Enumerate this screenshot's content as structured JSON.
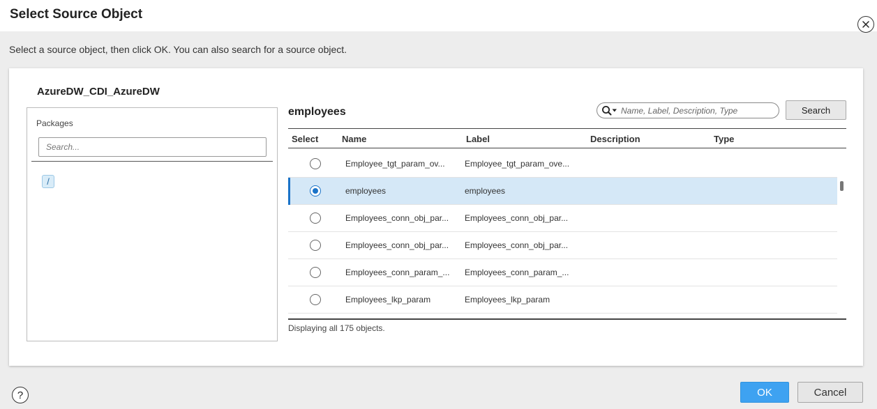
{
  "dialog": {
    "title": "Select Source Object",
    "instruction": "Select a source object, then click OK. You can also search for a source object."
  },
  "connection": {
    "name": "AzureDW_CDI_AzureDW"
  },
  "packages": {
    "label": "Packages",
    "search_placeholder": "Search...",
    "root": "/"
  },
  "objects": {
    "title": "employees",
    "search_placeholder": "Name, Label, Description, Type",
    "search_button": "Search",
    "columns": {
      "select": "Select",
      "name": "Name",
      "label": "Label",
      "description": "Description",
      "type": "Type"
    },
    "rows": [
      {
        "name": "Employee_tgt_param_ov...",
        "label": "Employee_tgt_param_ove...",
        "selected": false
      },
      {
        "name": "employees",
        "label": "employees",
        "selected": true
      },
      {
        "name": "Employees_conn_obj_par...",
        "label": "Employees_conn_obj_par...",
        "selected": false
      },
      {
        "name": "Employees_conn_obj_par...",
        "label": "Employees_conn_obj_par...",
        "selected": false
      },
      {
        "name": "Employees_conn_param_...",
        "label": "Employees_conn_param_...",
        "selected": false
      },
      {
        "name": "Employees_lkp_param",
        "label": "Employees_lkp_param",
        "selected": false
      }
    ],
    "status": "Displaying all 175 objects."
  },
  "footer": {
    "help": "?",
    "ok": "OK",
    "cancel": "Cancel"
  },
  "colors": {
    "accent": "#3ea2f1",
    "selected_row": "#d5e8f7"
  }
}
